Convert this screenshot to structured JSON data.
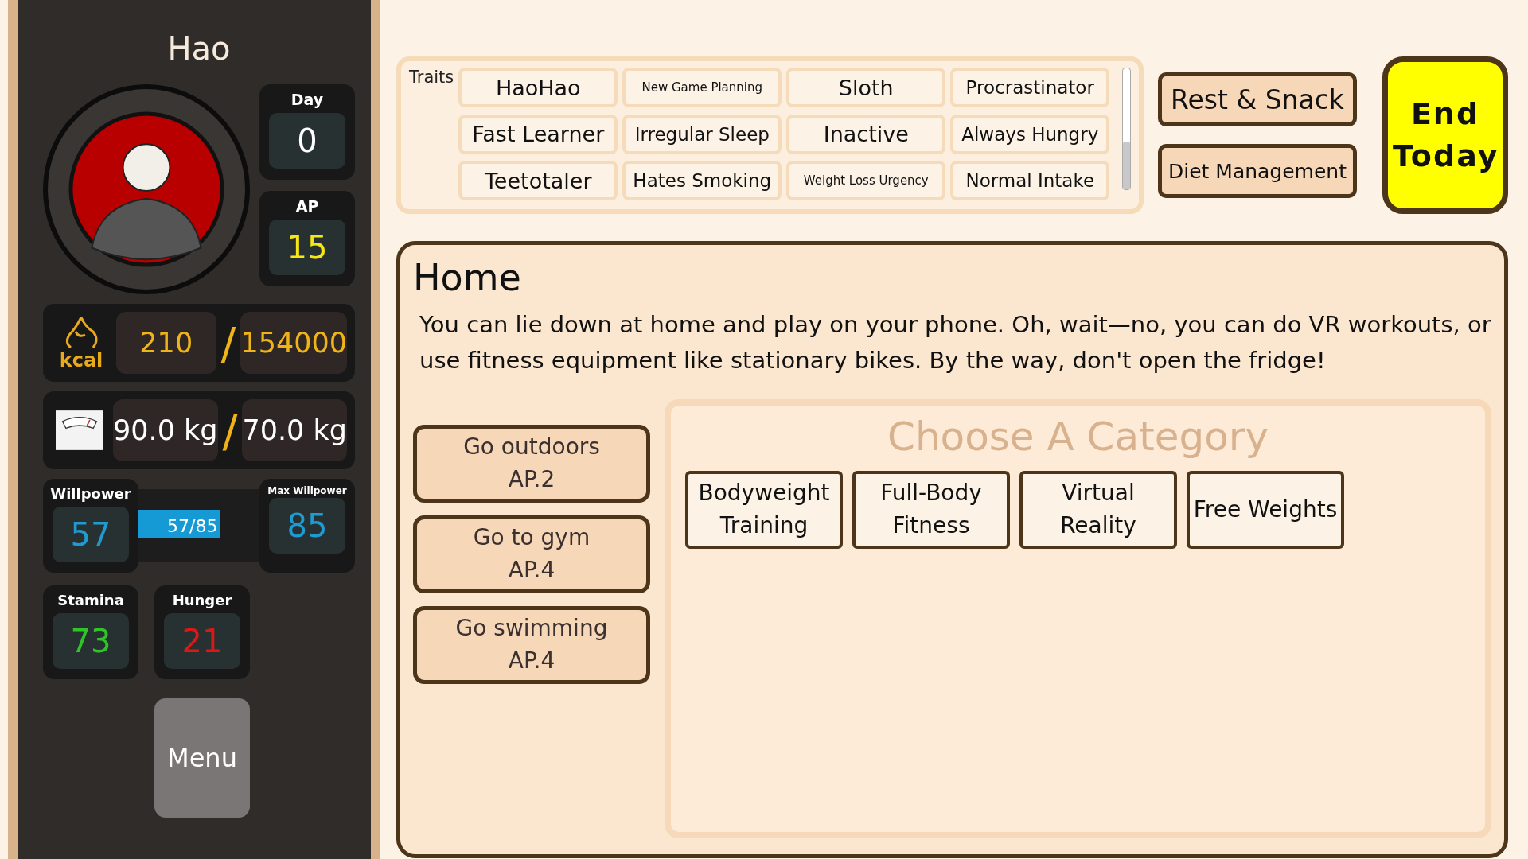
{
  "player": {
    "name": "Hao"
  },
  "day": {
    "label": "Day",
    "value": "0"
  },
  "ap": {
    "label": "AP",
    "value": "15"
  },
  "calories": {
    "unit": "kcal",
    "current": "210",
    "separator": "/",
    "target": "154000"
  },
  "weight": {
    "current": "90.0 kg",
    "separator": "/",
    "target": "70.0 kg"
  },
  "willpower": {
    "label": "Willpower",
    "value": "57",
    "bar_text": "57/85",
    "level": 0.67,
    "max_label": "Max Willpower",
    "max_value": "85"
  },
  "stamina": {
    "label": "Stamina",
    "value": "73"
  },
  "hunger": {
    "label": "Hunger",
    "value": "21"
  },
  "menu_button": "Menu",
  "traits": {
    "label": "Traits",
    "items": [
      {
        "name": "HaoHao",
        "kind": "large"
      },
      {
        "name": "New Game Planning",
        "kind": "small"
      },
      {
        "name": "Sloth",
        "kind": "large"
      },
      {
        "name": "Procrastinator",
        "kind": "medium"
      },
      {
        "name": "Fast Learner",
        "kind": "large"
      },
      {
        "name": "Irregular Sleep",
        "kind": "medium"
      },
      {
        "name": "Inactive",
        "kind": "large"
      },
      {
        "name": "Always Hungry",
        "kind": "medium"
      },
      {
        "name": "Teetotaler",
        "kind": "large"
      },
      {
        "name": "Hates Smoking",
        "kind": "medium"
      },
      {
        "name": "Weight Loss Urgency",
        "kind": "small"
      },
      {
        "name": "Normal Intake",
        "kind": "medium"
      }
    ]
  },
  "side_buttons": [
    "Rest & Snack",
    "Diet Management"
  ],
  "end_button": "End Today",
  "location": {
    "title": "Home",
    "description": "You can lie down at home and play on your phone. Oh, wait—no, you can do VR workouts, or use fitness equipment like stationary bikes. By the way, don't open the fridge!"
  },
  "actions": [
    {
      "name": "Go outdoors",
      "cost": "AP.2"
    },
    {
      "name": "Go to gym",
      "cost": "AP.4"
    },
    {
      "name": "Go swimming",
      "cost": "AP.4"
    }
  ],
  "category": {
    "heading": "Choose A Category",
    "options": [
      "Bodyweight Training",
      "Full-Body Fitness",
      "Virtual Reality",
      "Free Weights"
    ]
  }
}
